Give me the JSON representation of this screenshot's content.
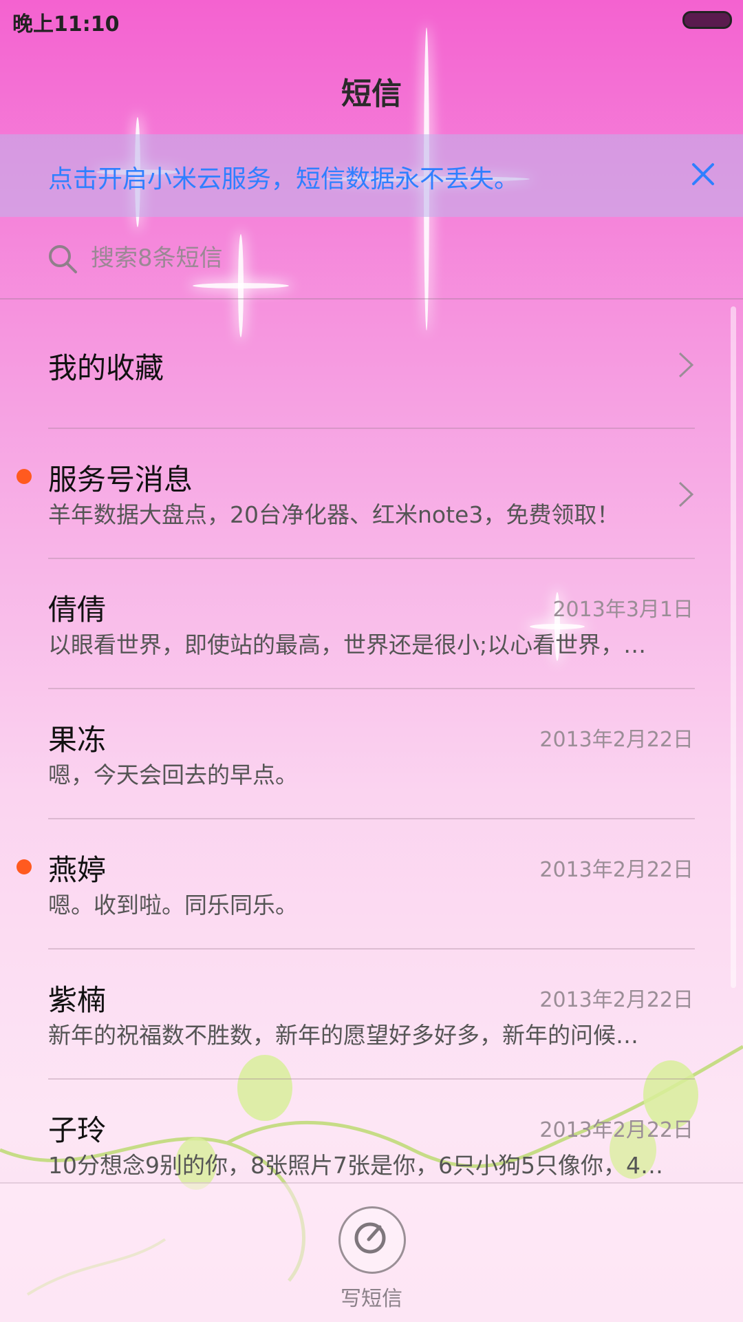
{
  "status_bar": {
    "time": "晚上11:10"
  },
  "header": {
    "title": "短信"
  },
  "cloud_banner": {
    "text": "点击开启小米云服务，短信数据永不丢失。"
  },
  "search": {
    "placeholder": "搜索8条短信"
  },
  "favorites": {
    "label": "我的收藏"
  },
  "conversations": [
    {
      "name": "服务号消息",
      "preview": "羊年数据大盘点，20台净化器、红米note3，免费领取！",
      "date": "",
      "unread": true
    },
    {
      "name": "倩倩",
      "preview": "以眼看世界，即使站的最高，世界还是很小;以心看世界，…",
      "date": "2013年3月1日",
      "unread": false
    },
    {
      "name": "果冻",
      "preview": "嗯，今天会回去的早点。",
      "date": "2013年2月22日",
      "unread": false
    },
    {
      "name": "燕婷",
      "preview": "嗯。收到啦。同乐同乐。",
      "date": "2013年2月22日",
      "unread": true
    },
    {
      "name": "紫楠",
      "preview": "新年的祝福数不胜数，新年的愿望好多好多，新年的问候…",
      "date": "2013年2月22日",
      "unread": false
    },
    {
      "name": "子玲",
      "preview": "10分想念9别的你，8张照片7张是你，6只小狗5只像你，4…",
      "date": "2013年2月22日",
      "unread": false
    }
  ],
  "compose": {
    "label": "写短信"
  },
  "colors": {
    "accent_blue": "#2f7fff",
    "unread_dot": "#ff5a1f"
  }
}
